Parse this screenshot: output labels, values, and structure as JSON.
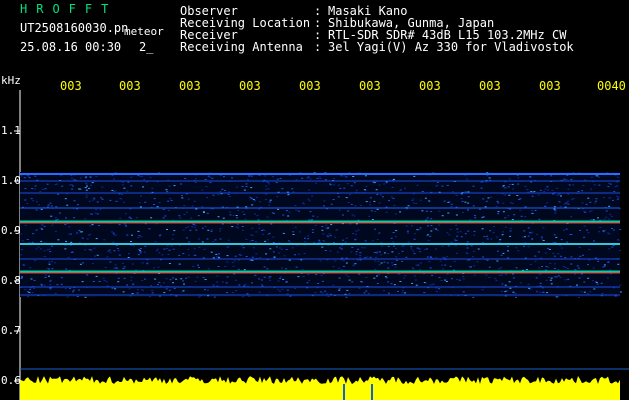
{
  "header": {
    "app_title": "HROFFT",
    "filename": "UT2508160030.pn",
    "meteor_label": "meteor",
    "datetime": "25.08.16 00:30",
    "page_indicator": "2_"
  },
  "info": [
    {
      "label": "Observer",
      "value": "Masaki Kano"
    },
    {
      "label": "Receiving Location",
      "value": "Shibukawa, Gunma, Japan"
    },
    {
      "label": "Receiver",
      "value": "RTL-SDR SDR# 43dB L15 103.2MHz CW"
    },
    {
      "label": "Receiving Antenna",
      "value": "3el Yagi(V) Az 330 for Vladivostok"
    }
  ],
  "info_separator": ":",
  "x_ticks": [
    "003",
    "003",
    "003",
    "003",
    "003",
    "003",
    "003",
    "003",
    "003",
    "0040"
  ],
  "y_axis": {
    "unit": "kHz",
    "ticks": [
      "1.1",
      "1.0",
      "0.9",
      "0.8",
      "0.7",
      "0.6"
    ]
  },
  "colors": {
    "background": "#000000",
    "title": "#00e080",
    "tick_label": "#ffff00",
    "text": "#ffffff",
    "signal_band": "#1030c8",
    "carrier_line": "#ff3030",
    "audio_level": "#ffff00"
  }
}
